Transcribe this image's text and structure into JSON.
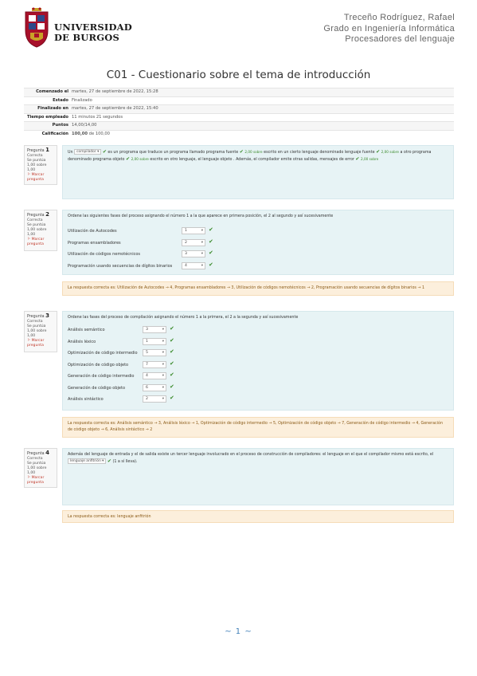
{
  "header": {
    "university_line1": "UNIVERSIDAD",
    "university_line2": "DE BURGOS",
    "author": "Treceño Rodríguez, Rafael",
    "degree": "Grado en Ingeniería Informática",
    "course": "Procesadores del lenguaje"
  },
  "title": "C01 - Cuestionario sobre el tema de introducción",
  "summary": [
    {
      "label": "Comenzado el",
      "value": "martes, 27 de septiembre de 2022, 15:28"
    },
    {
      "label": "Estado",
      "value": "Finalizado"
    },
    {
      "label": "Finalizado en",
      "value": "martes, 27 de septiembre de 2022, 15:40"
    },
    {
      "label": "Tiempo empleado",
      "value": "11 minutos 21 segundos"
    },
    {
      "label": "Puntos",
      "value": "14,00/14,00"
    },
    {
      "label": "Calificación",
      "value_bold": "100,00",
      "value_rest": " de 100,00"
    }
  ],
  "question_info": {
    "prefix": "Pregunta",
    "status": "Correcta",
    "score": "Se puntúa 1,00 sobre 1,00",
    "flag": "Marcar pregunta"
  },
  "q1": {
    "number": "1",
    "t1": "Un",
    "s1": "compilador",
    "t2": "es un programa que traduce un programa llamado programa fuente",
    "g1": "2,00 sobre",
    "t3": "escrito en un cierto lenguaje denominado lenguaje fuente",
    "g2": "2,00 sobre",
    "t4": "a otro programa denominado programa objeto",
    "g3": "2,00 sobre",
    "t5": "escrito en otro lenguaje, el lenguaje objeto",
    "t6": ". Además, el compilador emite otras salidas, mensajes de error",
    "g4": "2,00 sobre"
  },
  "q2": {
    "number": "2",
    "prompt": "Ordene las siguientes fases del proceso asignando el número 1 a la que aparece en primera posición, el 2 al segundo y así sucesivamente",
    "rows": [
      {
        "label": "Utilización de Autocodes",
        "value": "1"
      },
      {
        "label": "Programas ensambladores",
        "value": "2"
      },
      {
        "label": "Utilización de códigos nemotécnicos",
        "value": "3"
      },
      {
        "label": "Programación usando secuencias de dígitos binarios",
        "value": "4"
      }
    ],
    "feedback": "La respuesta correcta es: Utilización de Autocodes → 4, Programas ensambladores → 3, Utilización de códigos nemotécnicos → 2, Programación usando secuencias de dígitos binarios → 1"
  },
  "q3": {
    "number": "3",
    "prompt": "Ordene las fases del proceso de compilación asignando el número 1 a la primera, el 2 a la segunda y así sucesivamente",
    "rows": [
      {
        "label": "Análisis semántico",
        "value": "3"
      },
      {
        "label": "Análisis léxico",
        "value": "1"
      },
      {
        "label": "Optimización de código intermedio",
        "value": "5"
      },
      {
        "label": "Optimización de código objeto",
        "value": "7"
      },
      {
        "label": "Generación de código intermedio",
        "value": "4"
      },
      {
        "label": "Generación de código objeto",
        "value": "6"
      },
      {
        "label": "Análisis sintáctico",
        "value": "2"
      }
    ],
    "feedback": "La respuesta correcta es: Análisis semántico → 3, Análisis léxico → 1, Optimización de código intermedio → 5, Optimización de código objeto → 7, Generación de código intermedio → 4, Generación de código objeto → 6, Análisis sintáctico → 2"
  },
  "q4": {
    "number": "4",
    "t1": "Además del lenguaje de entrada y el de salida existe un tercer lenguaje involucrado en el proceso de construcción de compiladores: el lenguaje en el que el compilador mismo está escrito, el",
    "s1": "lenguaje anfitrión",
    "g1": "(1 a sí lleva).",
    "feedback": "La respuesta correcta es: lenguaje anfitrión"
  },
  "footer": {
    "page": "~ 1 ~"
  },
  "colors": {
    "accent": "#3f7fb8",
    "correct": "#3a8a2a",
    "content_bg": "#e7f3f5",
    "feedback_bg": "#fcefdc",
    "brand": "#a8102a"
  }
}
